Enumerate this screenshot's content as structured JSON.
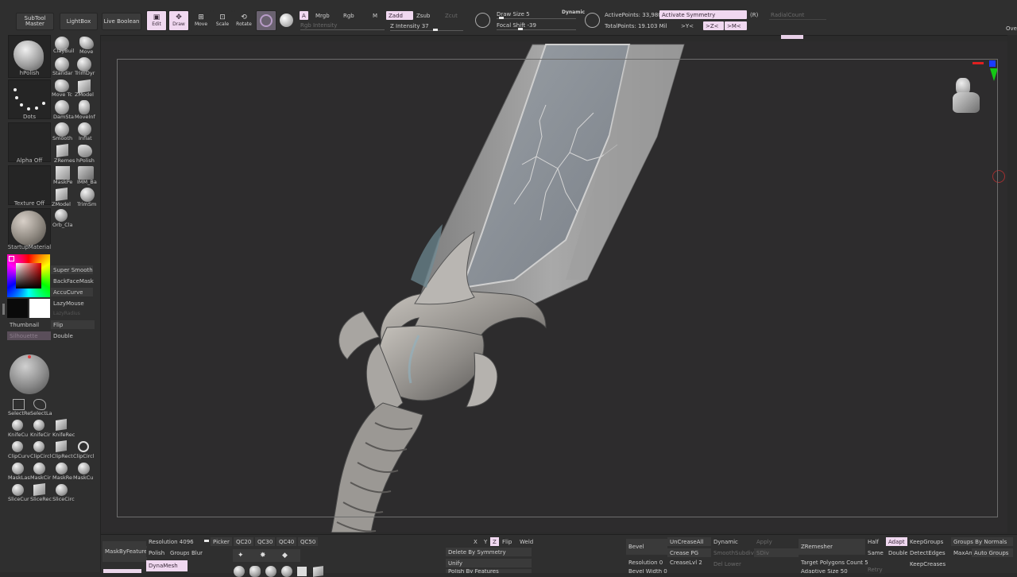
{
  "top": {
    "subtool_master": "SubTool\nMaster",
    "lightbox": "LightBox",
    "live_boolean": "Live Boolean",
    "edit": "Edit",
    "draw": "Draw",
    "move": "Move",
    "scale": "Scale",
    "rotate": "Rotate",
    "a": "A",
    "mrgb": "Mrgb",
    "rgb": "Rgb",
    "m": "M",
    "zadd": "Zadd",
    "zsub": "Zsub",
    "zcut": "Zcut",
    "rgb_intensity": "Rgb Intensity",
    "z_intensity": "Z Intensity 37",
    "draw_size": "Draw Size 5",
    "dynamic": "Dynamic",
    "focal_shift": "Focal Shift -39",
    "active_points": "ActivePoints: 33,980",
    "activate_symmetry": "Activate Symmetry",
    "r": "(R)",
    "radial_count": "RadialCount",
    "total_points": "TotalPoints: 19.103 Mil",
    "sym_x": ">X<",
    "sym_y": ">Y<",
    "sym_z": ">Z<",
    "sym_m": ">M<",
    "ove": "Ove"
  },
  "left": {
    "brush": "hPolish",
    "stroke": "Dots",
    "alpha": "Alpha Off",
    "texture": "Texture Off",
    "material": "StartupMaterial",
    "brushes": [
      "ClayBuil",
      "Move",
      "Standar",
      "TrimDyr",
      "Move Tc",
      "ZModel",
      "DamSta",
      "MoveInf",
      "Smooth",
      "Inflat",
      "ZRemes",
      "hPolish",
      "MaskPe",
      "IMM_Ba",
      "ZModel",
      "TrimSm",
      "Orb_Cla"
    ],
    "super_smooth": "Super Smooth",
    "backface_mask": "BackFaceMask",
    "accucurve": "AccuCurve",
    "lazymouse": "LazyMouse",
    "lazyradius": "LazyRadius",
    "thumbnail": "Thumbnail",
    "flip": "Flip",
    "silhouette": "Silhouette",
    "double": "Double",
    "tools": [
      "SelectRe",
      "SelectLa",
      "KnifeCu",
      "KnifeCir",
      "KnifeRec",
      "ClipCurv",
      "ClipCircl",
      "ClipRect",
      "ClipCircl",
      "MaskLas",
      "MaskCir",
      "MaskRe",
      "MaskCu",
      "SliceCur",
      "SliceRec",
      "SliceCirc"
    ]
  },
  "bottom": {
    "mask_by_feature": "MaskByFeature",
    "resolution": "Resolution 4096",
    "picker": "Picker",
    "qc20": "QC20",
    "qc30": "QC30",
    "qc40": "QC40",
    "qc50": "QC50",
    "polish": "Polish",
    "groups": "Groups",
    "blur": "Blur",
    "dynamesh": "DynaMesh",
    "x": "X",
    "y": "Y",
    "z": "Z",
    "flip": "Flip",
    "weld": "Weld",
    "delete_by_symmetry": "Delete By Symmetry",
    "unify": "Unify",
    "polish_by_features": "Polish By Features",
    "bevel": "Bevel",
    "resolution0": "Resolution 0",
    "bevel_width": "Bevel Width 0.05",
    "uncrease_all": "UnCreaseAll",
    "crease_pg": "Crease PG",
    "creaselvl": "CreaseLvl 2",
    "dynamic": "Dynamic",
    "smooth_subdiv": "SmoothSubdiv",
    "del_lower": "Del Lower",
    "apply": "Apply",
    "sdiv": "SDiv",
    "zremesher": "ZRemesher",
    "target_polygons": "Target Polygons Count 5",
    "adaptive_size": "Adaptive Size 50",
    "half": "Half",
    "same": "Same",
    "retry": "Retry",
    "adapt": "Adapt",
    "double": "Double",
    "keep_groups": "KeepGroups",
    "detect_edges": "DetectEdges",
    "keep_creases": "KeepCreases",
    "groups_by_normals": "Groups By Normals",
    "max_angle": "MaxAn",
    "auto_groups": "Auto Groups"
  },
  "colors": {
    "accent": "#f0d8f0",
    "panel": "#2f2f2f",
    "viewport": "#2d2c2d"
  }
}
